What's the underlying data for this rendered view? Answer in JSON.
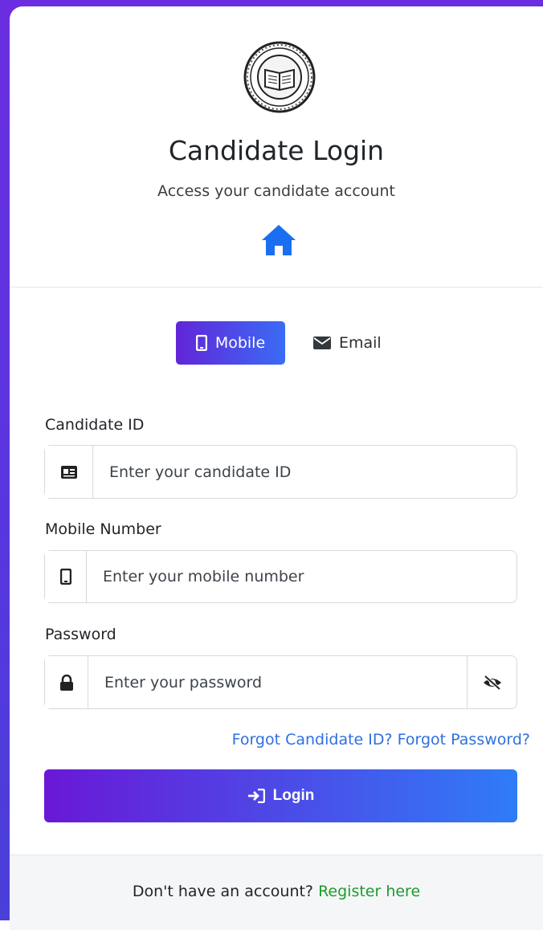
{
  "header": {
    "title": "Candidate Login",
    "subtitle": "Access your candidate account",
    "logo_icon": "book-seal-logo",
    "home_icon": "home-icon"
  },
  "tabs": [
    {
      "label": "Mobile",
      "icon": "mobile-icon",
      "active": true
    },
    {
      "label": "Email",
      "icon": "envelope-icon",
      "active": false
    }
  ],
  "form": {
    "candidate_id": {
      "label": "Candidate ID",
      "placeholder": "Enter your candidate ID",
      "value": ""
    },
    "mobile": {
      "label": "Mobile Number",
      "placeholder": "Enter your mobile number",
      "value": ""
    },
    "password": {
      "label": "Password",
      "placeholder": "Enter your password",
      "value": ""
    }
  },
  "links": {
    "forgot_id": "Forgot Candidate ID?",
    "forgot_password": "Forgot Password?"
  },
  "login_button": {
    "label": "Login"
  },
  "footer": {
    "prompt": "Don't have an account?",
    "register_link": "Register here"
  },
  "colors": {
    "accent_start": "#6a18d6",
    "accent_end": "#2f7cf7",
    "link_blue": "#2f6fe0",
    "register_green": "#1d9b2d",
    "home_blue": "#1a6ff0"
  }
}
